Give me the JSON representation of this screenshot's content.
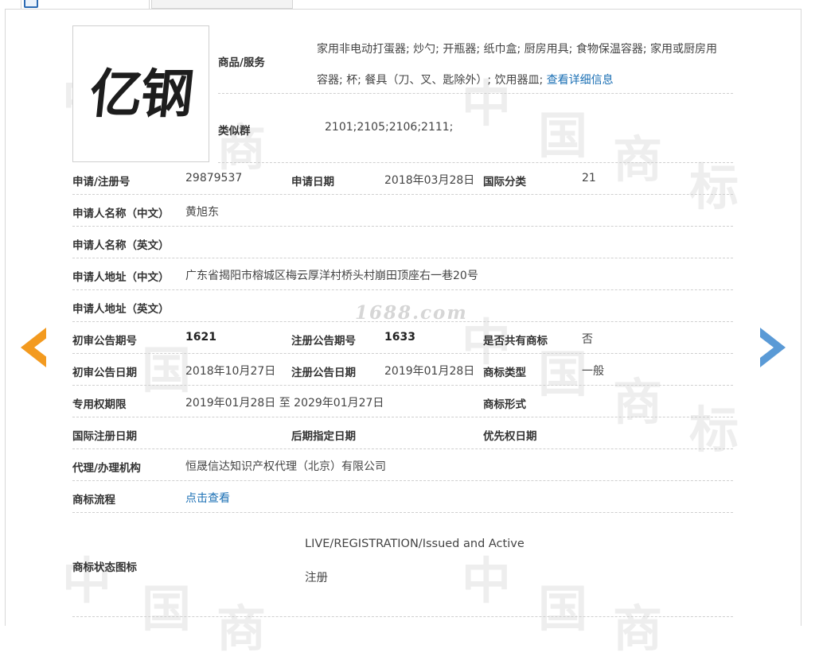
{
  "logo": {
    "text": "亿钢"
  },
  "watermark": {
    "site": "1688.com",
    "glyphs": [
      "中",
      "国",
      "商",
      "标"
    ]
  },
  "goods": {
    "label": "商品/服务",
    "text": "家用非电动打蛋器; 炒勺; 开瓶器; 纸巾盒; 厨房用具; 食物保温容器; 家用或厨房用容器; 杯; 餐具（刀、叉、匙除外）; 饮用器皿;",
    "detail_link": "查看详细信息"
  },
  "similar_group": {
    "label": "类似群",
    "value": "2101;2105;2106;2111;"
  },
  "fields": {
    "reg_no": {
      "label": "申请/注册号",
      "value": "29879537"
    },
    "app_date": {
      "label": "申请日期",
      "value": "2018年03月28日"
    },
    "intl_class": {
      "label": "国际分类",
      "value": "21"
    },
    "applicant_cn": {
      "label": "申请人名称（中文）",
      "value": "黄旭东"
    },
    "applicant_en": {
      "label": "申请人名称（英文）",
      "value": ""
    },
    "address_cn": {
      "label": "申请人地址（中文）",
      "value": "广东省揭阳市榕城区梅云厚洋村桥头村崩田顶座右一巷20号"
    },
    "address_en": {
      "label": "申请人地址（英文）",
      "value": ""
    },
    "prelim_pub_no": {
      "label": "初审公告期号",
      "value": "1621"
    },
    "reg_pub_no": {
      "label": "注册公告期号",
      "value": "1633"
    },
    "shared": {
      "label": "是否共有商标",
      "value": "否"
    },
    "prelim_pub_date": {
      "label": "初审公告日期",
      "value": "2018年10月27日"
    },
    "reg_pub_date": {
      "label": "注册公告日期",
      "value": "2019年01月28日"
    },
    "tm_type": {
      "label": "商标类型",
      "value": "一般"
    },
    "exclusive_period": {
      "label": "专用权期限",
      "value": "2019年01月28日 至 2029年01月27日"
    },
    "tm_form": {
      "label": "商标形式",
      "value": ""
    },
    "intl_reg_date": {
      "label": "国际注册日期",
      "value": ""
    },
    "later_designation": {
      "label": "后期指定日期",
      "value": ""
    },
    "priority_date": {
      "label": "优先权日期",
      "value": ""
    },
    "agent": {
      "label": "代理/办理机构",
      "value": "恒晟信达知识产权代理（北京）有限公司"
    },
    "process": {
      "label": "商标流程",
      "link": "点击查看"
    },
    "status": {
      "label": "商标状态图标",
      "line1": "LIVE/REGISTRATION/Issued and Active",
      "line2": "注册"
    }
  },
  "nav": {
    "prev": "previous-arrow",
    "next": "next-arrow"
  },
  "colors": {
    "link": "#1a6fb4",
    "prev_arrow": "#f39a1f",
    "next_arrow": "#5a9ad6",
    "divider": "#cfcfcf"
  }
}
